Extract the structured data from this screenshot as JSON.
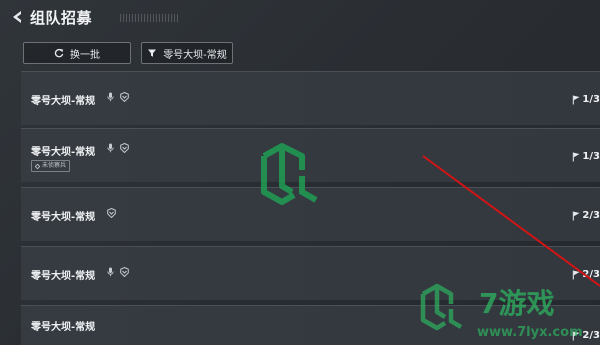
{
  "header": {
    "title": "组队招募"
  },
  "toolbar": {
    "refresh_label": "换一批",
    "filter_label": "零号大坝-常规"
  },
  "rows": [
    {
      "name": "零号大坝-常规",
      "tag": "",
      "count": "1/3"
    },
    {
      "name": "零号大坝-常规",
      "tag": "未侦察兵",
      "count": "1/3"
    },
    {
      "name": "零号大坝-常规",
      "tag": "",
      "count": "2/3"
    },
    {
      "name": "零号大坝-常规",
      "tag": "",
      "count": "2/3"
    },
    {
      "name": "零号大坝-常规",
      "tag": "",
      "count": "2/3"
    }
  ],
  "watermark": {
    "brand": "7游戏",
    "url": "www.7lyx.com"
  },
  "colors": {
    "background": "#2a2e33",
    "row": "#363b41",
    "watermark_green": "#1f9e54",
    "arrow_red": "#d21414"
  }
}
